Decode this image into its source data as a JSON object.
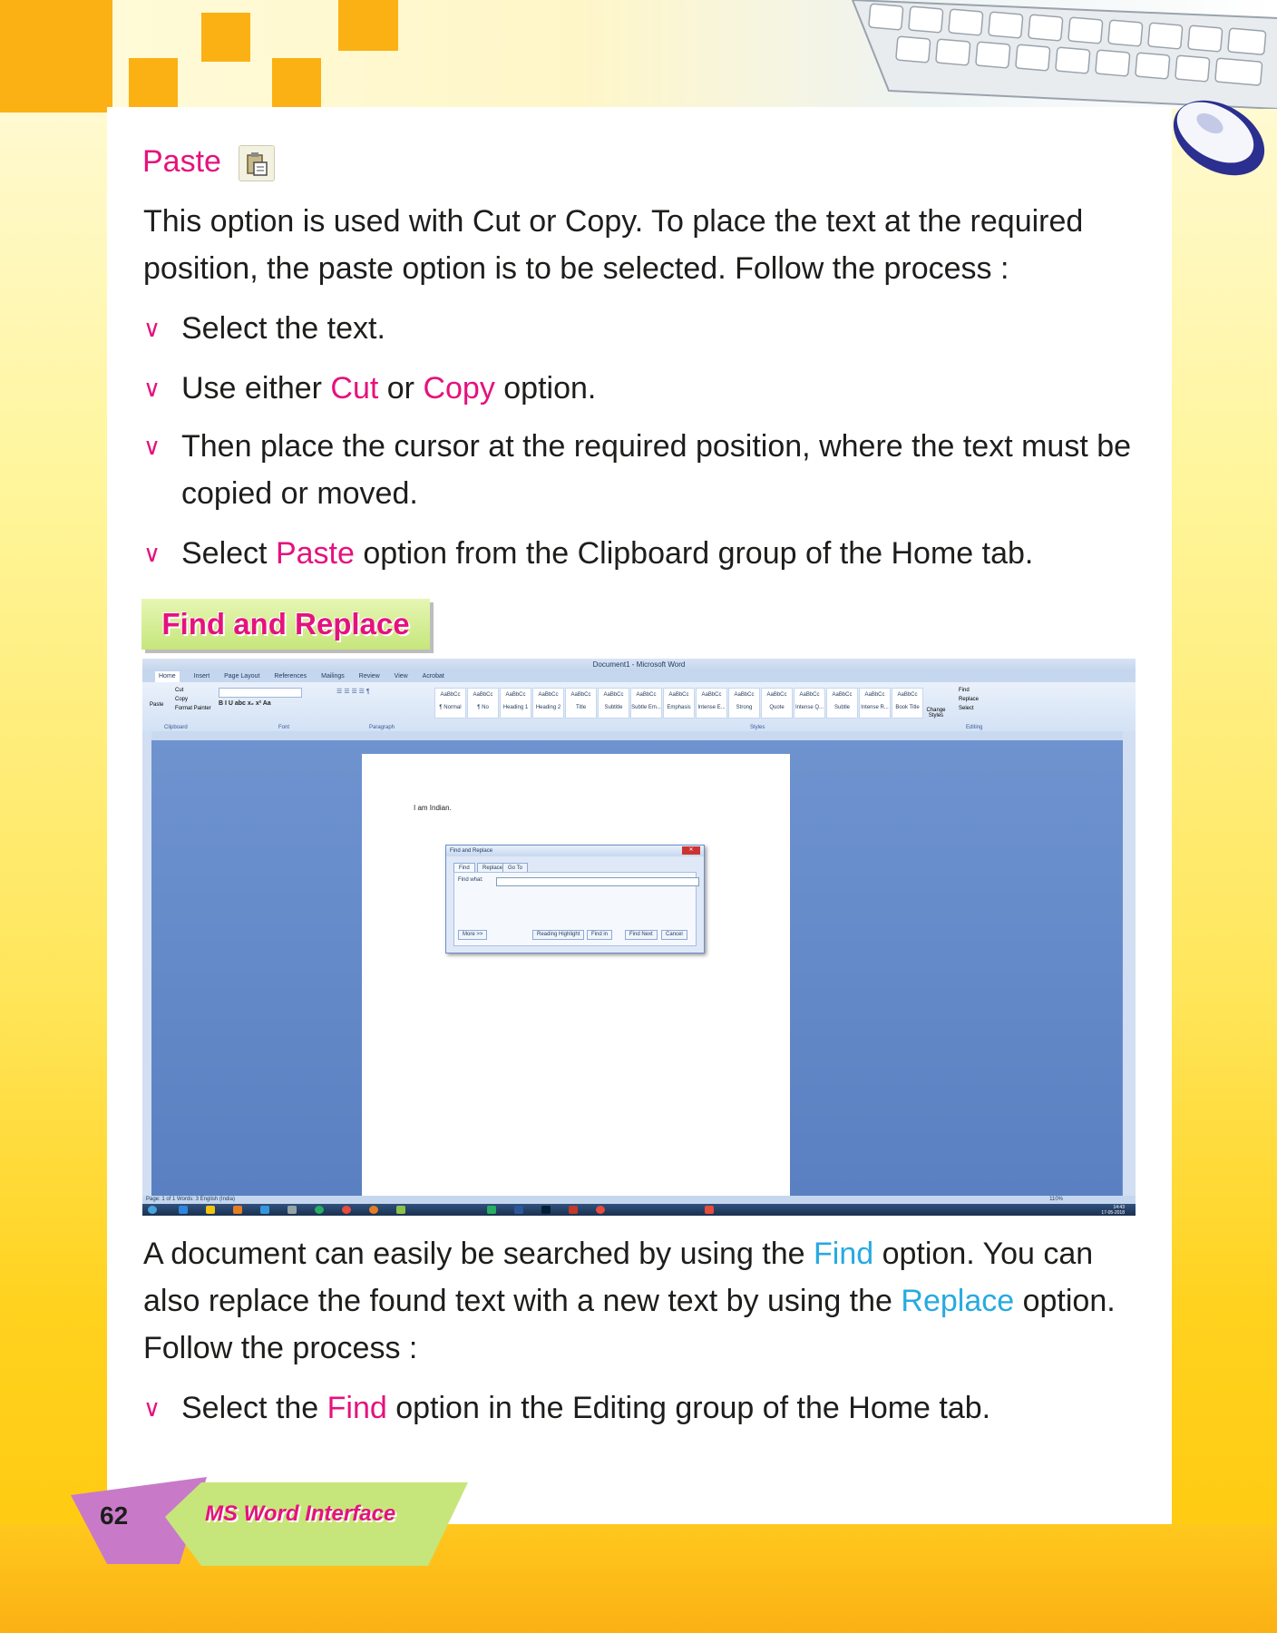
{
  "paste_section": {
    "heading": "Paste",
    "intro": "This option is used with Cut or Copy. To place the text at the required position, the paste option is to be selected. Follow the process :",
    "steps": [
      {
        "before": "Select the text.",
        "highlight": "",
        "after": ""
      },
      {
        "before": "Use either ",
        "highlight": "Cut",
        "middle": " or ",
        "highlight2": "Copy",
        "after": " option."
      },
      {
        "before": "Then place the cursor at the required position, where the text must be copied or moved.",
        "highlight": "",
        "after": ""
      },
      {
        "before": "Select ",
        "highlight": "Paste",
        "after": " option from the Clipboard group of the Home tab."
      }
    ]
  },
  "find_replace": {
    "banner": "Find and Replace",
    "para_part1": "A document can easily be searched by using the ",
    "para_find": "Find",
    "para_part2": " option. You can also replace the found text with a new text by using the ",
    "para_replace": "Replace",
    "para_part3": " option. Follow the process :",
    "step_before": "Select the ",
    "step_highlight": "Find",
    "step_after": " option in the Editing group of the Home tab."
  },
  "screenshot": {
    "window_title": "Document1 - Microsoft Word",
    "tabs": [
      "Home",
      "Insert",
      "Page Layout",
      "References",
      "Mailings",
      "Review",
      "View",
      "Acrobat"
    ],
    "clipboard": {
      "paste": "Paste",
      "cut": "Cut",
      "copy": "Copy",
      "format_painter": "Format Painter",
      "group": "Clipboard"
    },
    "groups": {
      "font": "Font",
      "paragraph": "Paragraph",
      "styles": "Styles",
      "editing": "Editing"
    },
    "styles": [
      "¶ Normal",
      "¶ No Spaci...",
      "Heading 1",
      "Heading 2",
      "Title",
      "Subtitle",
      "Subtle Em...",
      "Emphasis",
      "Intense E...",
      "Strong",
      "Quote",
      "Intense Q...",
      "Subtle Ref...",
      "Intense R...",
      "Book Title"
    ],
    "change_styles": "Change Styles",
    "editing": {
      "find": "Find",
      "replace": "Replace",
      "select": "Select"
    },
    "doc_text": "I am Indian.",
    "dialog": {
      "title": "Find and Replace",
      "tabs": [
        "Find",
        "Replace",
        "Go To"
      ],
      "find_label": "Find what:",
      "more": "More >>",
      "reading_highlight": "Reading Highlight",
      "find_in": "Find in",
      "find_next": "Find Next",
      "cancel": "Cancel"
    },
    "status": "Page: 1 of 1   Words: 3   English (India)",
    "zoom": "110%",
    "clock_time": "14:43",
    "clock_date": "17-05-2018"
  },
  "footer": {
    "page_number": "62",
    "chapter": "MS Word Interface"
  },
  "colors": {
    "accent_pink": "#e5127d",
    "accent_cyan": "#27aae1",
    "orange": "#fbb113",
    "banner_green": "#c6e67b"
  }
}
